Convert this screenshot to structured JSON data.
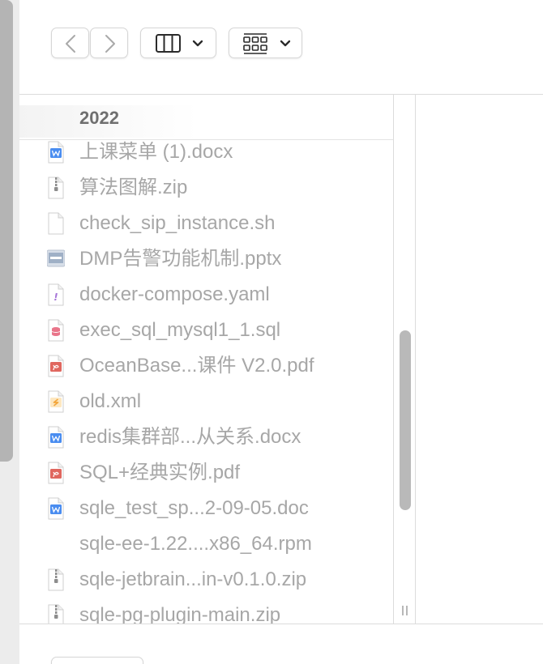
{
  "toolbar": {
    "back_icon": "chevron-left-icon",
    "forward_icon": "chevron-right-icon",
    "view_icon": "column-view-icon",
    "group_icon": "grid-group-icon"
  },
  "column": {
    "title": "2022",
    "files": [
      {
        "name": "上课菜单 (1).docx",
        "icon": "word"
      },
      {
        "name": "算法图解.zip",
        "icon": "zip"
      },
      {
        "name": "check_sip_instance.sh",
        "icon": "blank"
      },
      {
        "name": "DMP告警功能机制.pptx",
        "icon": "pptx"
      },
      {
        "name": "docker-compose.yaml",
        "icon": "yaml"
      },
      {
        "name": "exec_sql_mysql1_1.sql",
        "icon": "sql"
      },
      {
        "name": "OceanBase...课件 V2.0.pdf",
        "icon": "pdf"
      },
      {
        "name": "old.xml",
        "icon": "xml"
      },
      {
        "name": "redis集群部...从关系.docx",
        "icon": "word"
      },
      {
        "name": "SQL+经典实例.pdf",
        "icon": "pdf"
      },
      {
        "name": "sqle_test_sp...2-09-05.doc",
        "icon": "word"
      },
      {
        "name": "sqle-ee-1.22....x86_64.rpm",
        "icon": "none"
      },
      {
        "name": "sqle-jetbrain...in-v0.1.0.zip",
        "icon": "zip"
      },
      {
        "name": "sqle-pg-plugin-main.zip",
        "icon": "zip"
      }
    ]
  },
  "colors": {
    "text_dim": "#a7a7a7",
    "word_blue": "#4a8df0",
    "pdf_red": "#e0675f",
    "sql_pink": "#e9758a",
    "xml_orange": "#f2a53a",
    "yaml_purple": "#a776d8"
  }
}
